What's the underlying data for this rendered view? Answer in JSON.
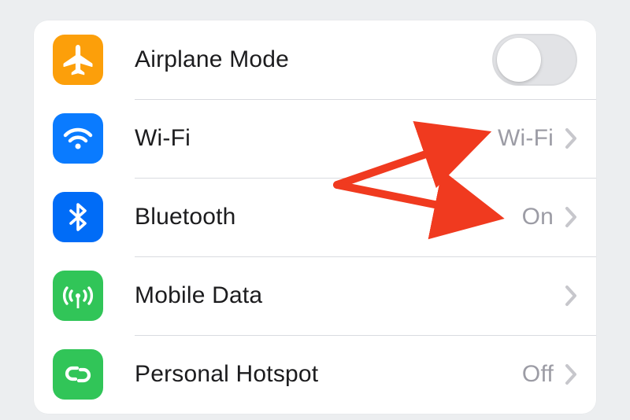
{
  "settings": {
    "items": [
      {
        "key": "airplane",
        "label": "Airplane Mode",
        "airplane_on": false
      },
      {
        "key": "wifi",
        "label": "Wi-Fi",
        "value": "Wi-Fi"
      },
      {
        "key": "bluetooth",
        "label": "Bluetooth",
        "value": "On"
      },
      {
        "key": "mobile",
        "label": "Mobile Data",
        "value": ""
      },
      {
        "key": "hotspot",
        "label": "Personal Hotspot",
        "value": "Off"
      }
    ]
  },
  "colors": {
    "accent_orange": "#fc9f0a",
    "accent_blue": "#0a7bff",
    "accent_green": "#31c558",
    "chevron": "#c7c7cc",
    "value_text": "#9c9ca5",
    "annotation_red": "#f03a1f"
  }
}
